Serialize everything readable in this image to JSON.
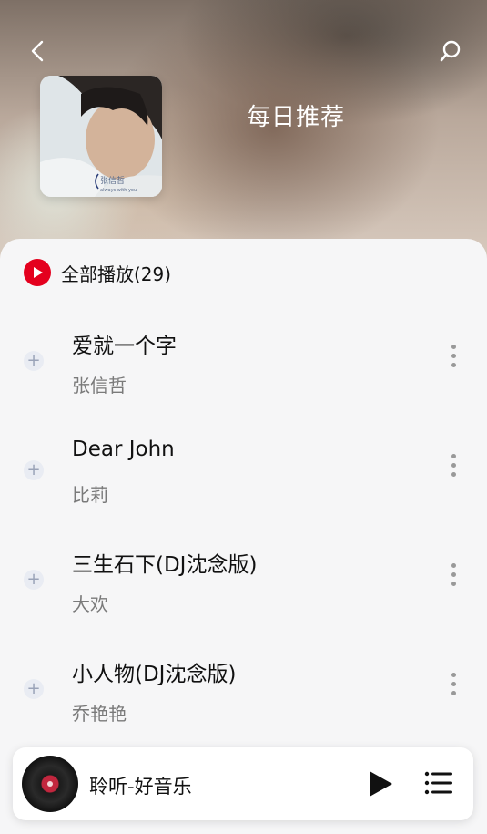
{
  "header": {
    "title": "每日推荐",
    "cover_text": "张信哲",
    "cover_subtext": "always with you"
  },
  "play_all": {
    "label": "全部播放(29)"
  },
  "songs": [
    {
      "name": "爱就一个字",
      "artist": "张信哲"
    },
    {
      "name": "Dear John",
      "artist": "比莉"
    },
    {
      "name": "三生石下(DJ沈念版)",
      "artist": "大欢"
    },
    {
      "name": "小人物(DJ沈念版)",
      "artist": "乔艳艳"
    }
  ],
  "player": {
    "title": "聆听-好音乐"
  },
  "colors": {
    "accent": "#e4001e",
    "panel_bg": "#f6f6f7"
  },
  "icons": [
    "back-icon",
    "search-icon",
    "play-circle-icon",
    "plus-icon",
    "more-vertical-icon",
    "play-icon",
    "playlist-icon"
  ]
}
